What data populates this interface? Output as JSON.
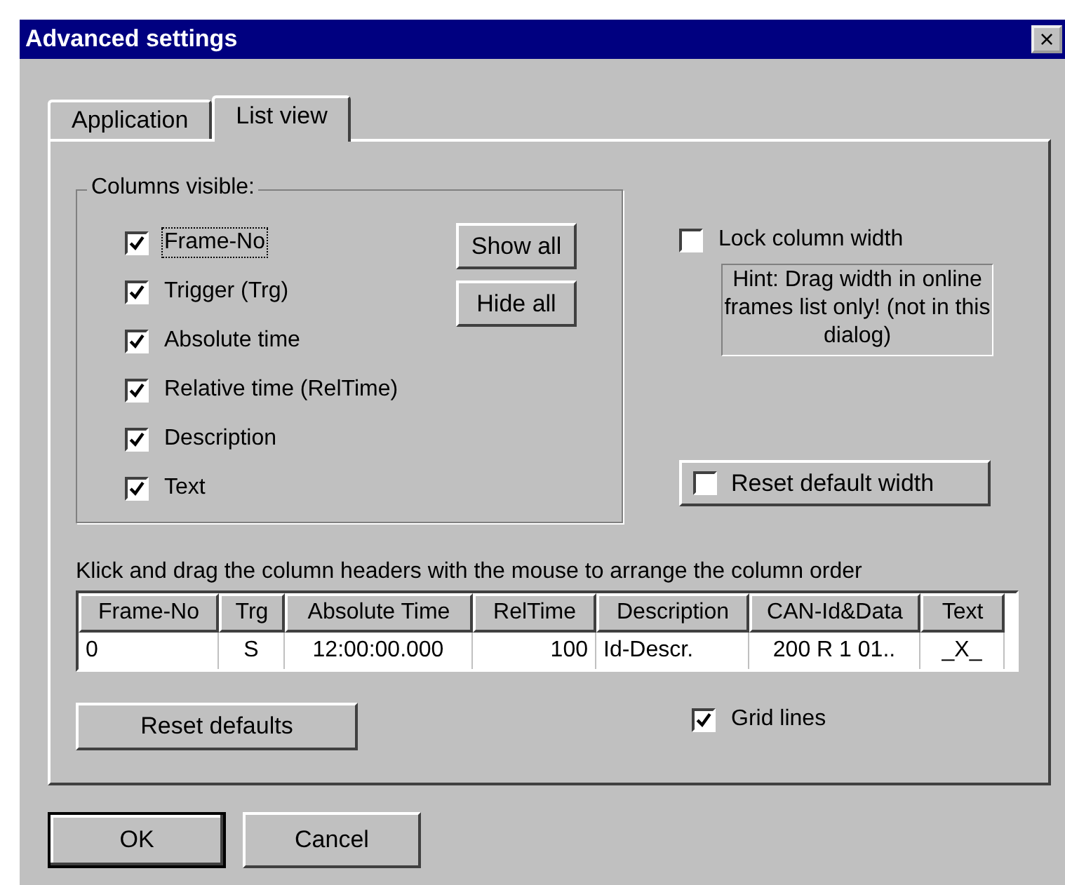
{
  "window": {
    "title": "Advanced settings",
    "close": "×"
  },
  "tabs": [
    {
      "label": "Application",
      "selected": false
    },
    {
      "label": "List view",
      "selected": true
    }
  ],
  "columns_group": {
    "title": "Columns visible:",
    "items": [
      {
        "label": "Frame-No",
        "checked": true,
        "focused": true
      },
      {
        "label": "Trigger (Trg)",
        "checked": true,
        "focused": false
      },
      {
        "label": "Absolute time",
        "checked": true,
        "focused": false
      },
      {
        "label": "Relative time (RelTime)",
        "checked": true,
        "focused": false
      },
      {
        "label": "Description",
        "checked": true,
        "focused": false
      },
      {
        "label": "Text",
        "checked": true,
        "focused": false
      }
    ],
    "buttons": [
      "Show all",
      "Hide all"
    ]
  },
  "lock_width": {
    "label": "Lock column width",
    "checked": false
  },
  "hint": "Hint: Drag width in online frames list only! (not in this dialog)",
  "reset_width": {
    "label": "Reset default width",
    "checked": false
  },
  "instruction": "Klick and drag the column headers with the mouse to arrange the column order",
  "table": {
    "columns": [
      "Frame-No",
      "Trg",
      "Absolute Time",
      "RelTime",
      "Description",
      "CAN-Id&Data",
      "Text"
    ],
    "rows": [
      [
        "0",
        "S",
        "12:00:00.000",
        "100",
        "Id-Descr.",
        "200 R 1 01..",
        "_X_"
      ]
    ]
  },
  "reset_defaults": "Reset defaults",
  "grid_lines": {
    "label": "Grid lines",
    "checked": true
  },
  "buttons": [
    {
      "label": "OK",
      "default": true
    },
    {
      "label": "Cancel",
      "default": false
    }
  ]
}
